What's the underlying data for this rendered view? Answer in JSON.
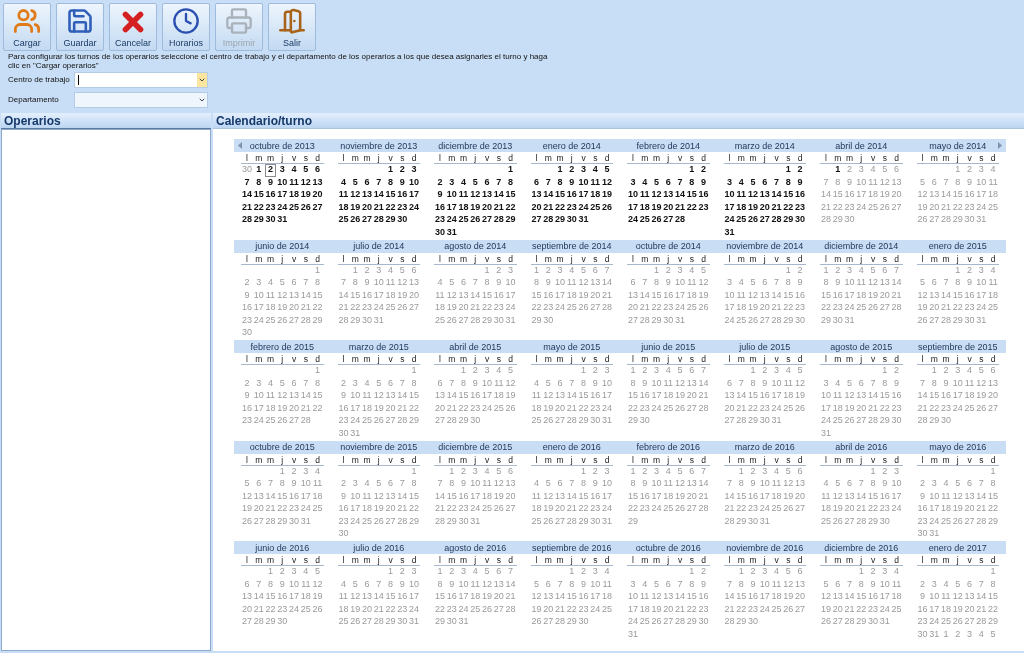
{
  "toolbar": [
    {
      "label": "Cargar",
      "kind": "users",
      "disabled": false
    },
    {
      "label": "Guardar",
      "kind": "save",
      "disabled": false
    },
    {
      "label": "Cancelar",
      "kind": "cancel",
      "disabled": false
    },
    {
      "label": "Horarios",
      "kind": "clock",
      "disabled": false
    },
    {
      "label": "Imprimir",
      "kind": "print",
      "disabled": true
    },
    {
      "label": "Salir",
      "kind": "exit",
      "disabled": false
    }
  ],
  "instructions": "Para configurar los turnos de los operarios seleccione el centro de trabajo y el departamento de los operarios a los que desea asignarles el turno y haga clic en \"Cargar operarios\"",
  "fields": [
    {
      "label": "Centro de trabajo",
      "focused": true
    },
    {
      "label": "Departamento",
      "focused": false
    }
  ],
  "operators_panel": {
    "title": "Operarios"
  },
  "calendar": {
    "title": "Calendario/turno",
    "months": [
      {
        "title": "octubre de 2013",
        "active": true,
        "today_is_second_day": true,
        "weekdays": [
          "l",
          "m",
          "m",
          "j",
          "v",
          "s",
          "d"
        ],
        "prev_days": [
          "30"
        ],
        "weeks": [
          [
            "1",
            "2",
            "3",
            "4",
            "5",
            "6"
          ],
          [
            "7",
            "8",
            "9",
            "10",
            "11",
            "12",
            "13"
          ],
          [
            "14",
            "15",
            "16",
            "17",
            "18",
            "19",
            "20"
          ],
          [
            "21",
            "22",
            "23",
            "24",
            "25",
            "26",
            "27"
          ],
          [
            "28",
            "29",
            "30",
            "31"
          ]
        ]
      },
      {
        "title": "noviembre de 2013",
        "active": true,
        "weekdays": [
          "l",
          "m",
          "m",
          "j",
          "v",
          "s",
          "d"
        ],
        "weeks": [
          [
            "1",
            "2",
            "3"
          ],
          [
            "4",
            "5",
            "6",
            "7",
            "8",
            "9",
            "10"
          ],
          [
            "11",
            "12",
            "13",
            "14",
            "15",
            "16",
            "17"
          ],
          [
            "18",
            "19",
            "20",
            "21",
            "22",
            "23",
            "24"
          ],
          [
            "25",
            "26",
            "27",
            "28",
            "29",
            "30"
          ]
        ]
      },
      {
        "title": "diciembre de 2013",
        "active": true,
        "weekdays": [
          "l",
          "m",
          "m",
          "j",
          "v",
          "s",
          "d"
        ],
        "weeks": [
          [
            "1"
          ],
          [
            "2",
            "3",
            "4",
            "5",
            "6",
            "7",
            "8"
          ],
          [
            "9",
            "10",
            "11",
            "12",
            "13",
            "14",
            "15"
          ],
          [
            "16",
            "17",
            "18",
            "19",
            "20",
            "21",
            "22"
          ],
          [
            "23",
            "24",
            "25",
            "26",
            "27",
            "28",
            "29"
          ],
          [
            "30",
            "31"
          ]
        ]
      },
      {
        "title": "enero de 2014",
        "active": true,
        "weekdays": [
          "l",
          "m",
          "m",
          "j",
          "v",
          "s",
          "d"
        ],
        "weeks": [
          [
            "1",
            "2",
            "3",
            "4",
            "5"
          ],
          [
            "6",
            "7",
            "8",
            "9",
            "10",
            "11",
            "12"
          ],
          [
            "13",
            "14",
            "15",
            "16",
            "17",
            "18",
            "19"
          ],
          [
            "20",
            "21",
            "22",
            "23",
            "24",
            "25",
            "26"
          ],
          [
            "27",
            "28",
            "29",
            "30",
            "31"
          ]
        ]
      },
      {
        "title": "febrero de 2014",
        "active": true,
        "weekdays": [
          "l",
          "m",
          "m",
          "j",
          "v",
          "s",
          "d"
        ],
        "weeks": [
          [
            "1",
            "2"
          ],
          [
            "3",
            "4",
            "5",
            "6",
            "7",
            "8",
            "9"
          ],
          [
            "10",
            "11",
            "12",
            "13",
            "14",
            "15",
            "16"
          ],
          [
            "17",
            "18",
            "19",
            "20",
            "21",
            "22",
            "23"
          ],
          [
            "24",
            "25",
            "26",
            "27",
            "28"
          ]
        ]
      },
      {
        "title": "marzo de 2014",
        "active": true,
        "weekdays": [
          "l",
          "m",
          "m",
          "j",
          "v",
          "s",
          "d"
        ],
        "weeks": [
          [
            "1",
            "2"
          ],
          [
            "3",
            "4",
            "5",
            "6",
            "7",
            "8",
            "9"
          ],
          [
            "10",
            "11",
            "12",
            "13",
            "14",
            "15",
            "16"
          ],
          [
            "17",
            "18",
            "19",
            "20",
            "21",
            "22",
            "23"
          ],
          [
            "24",
            "25",
            "26",
            "27",
            "28",
            "29",
            "30"
          ],
          [
            "31"
          ]
        ]
      },
      {
        "title": "abril de 2014",
        "active": false,
        "weekdays": [
          "l",
          "m",
          "m",
          "j",
          "v",
          "s",
          "d"
        ],
        "active_lead_days": [
          "1"
        ],
        "weeks": [
          [
            "2",
            "3",
            "4",
            "5",
            "6"
          ],
          [
            "7",
            "8",
            "9",
            "10",
            "11",
            "12",
            "13"
          ],
          [
            "14",
            "15",
            "16",
            "17",
            "18",
            "19",
            "20"
          ],
          [
            "21",
            "22",
            "23",
            "24",
            "25",
            "26",
            "27"
          ],
          [
            "28",
            "29",
            "30"
          ]
        ]
      },
      {
        "title": "mayo de 2014",
        "active": false,
        "weekdays": [
          "l",
          "m",
          "m",
          "j",
          "v",
          "s",
          "d"
        ],
        "weeks": [
          [
            "1",
            "2",
            "3",
            "4"
          ],
          [
            "5",
            "6",
            "7",
            "8",
            "9",
            "10",
            "11"
          ],
          [
            "12",
            "13",
            "14",
            "15",
            "16",
            "17",
            "18"
          ],
          [
            "19",
            "20",
            "21",
            "22",
            "23",
            "24",
            "25"
          ],
          [
            "26",
            "27",
            "28",
            "29",
            "30",
            "31"
          ]
        ]
      },
      {
        "title": "junio de 2014",
        "active": false,
        "weekdays": [
          "l",
          "m",
          "m",
          "j",
          "v",
          "s",
          "d"
        ],
        "weeks": [
          [
            "1"
          ],
          [
            "2",
            "3",
            "4",
            "5",
            "6",
            "7",
            "8"
          ],
          [
            "9",
            "10",
            "11",
            "12",
            "13",
            "14",
            "15"
          ],
          [
            "16",
            "17",
            "18",
            "19",
            "20",
            "21",
            "22"
          ],
          [
            "23",
            "24",
            "25",
            "26",
            "27",
            "28",
            "29"
          ],
          [
            "30"
          ]
        ]
      },
      {
        "title": "julio de 2014",
        "active": false,
        "weekdays": [
          "l",
          "m",
          "m",
          "j",
          "v",
          "s",
          "d"
        ],
        "weeks": [
          [
            "1",
            "2",
            "3",
            "4",
            "5",
            "6"
          ],
          [
            "7",
            "8",
            "9",
            "10",
            "11",
            "12",
            "13"
          ],
          [
            "14",
            "15",
            "16",
            "17",
            "18",
            "19",
            "20"
          ],
          [
            "21",
            "22",
            "23",
            "24",
            "25",
            "26",
            "27"
          ],
          [
            "28",
            "29",
            "30",
            "31"
          ]
        ]
      },
      {
        "title": "agosto de 2014",
        "active": false,
        "weekdays": [
          "l",
          "m",
          "m",
          "j",
          "v",
          "s",
          "d"
        ],
        "weeks": [
          [
            "1",
            "2",
            "3"
          ],
          [
            "4",
            "5",
            "6",
            "7",
            "8",
            "9",
            "10"
          ],
          [
            "11",
            "12",
            "13",
            "14",
            "15",
            "16",
            "17"
          ],
          [
            "18",
            "19",
            "20",
            "21",
            "22",
            "23",
            "24"
          ],
          [
            "25",
            "26",
            "27",
            "28",
            "29",
            "30",
            "31"
          ]
        ]
      },
      {
        "title": "septiembre de 2014",
        "active": false,
        "weekdays": [
          "l",
          "m",
          "m",
          "j",
          "v",
          "s",
          "d"
        ],
        "weeks": [
          [
            "1",
            "2",
            "3",
            "4",
            "5",
            "6",
            "7"
          ],
          [
            "8",
            "9",
            "10",
            "11",
            "12",
            "13",
            "14"
          ],
          [
            "15",
            "16",
            "17",
            "18",
            "19",
            "20",
            "21"
          ],
          [
            "22",
            "23",
            "24",
            "25",
            "26",
            "27",
            "28"
          ],
          [
            "29",
            "30"
          ]
        ]
      },
      {
        "title": "octubre de 2014",
        "active": false,
        "weekdays": [
          "l",
          "m",
          "m",
          "j",
          "v",
          "s",
          "d"
        ],
        "weeks": [
          [
            "1",
            "2",
            "3",
            "4",
            "5"
          ],
          [
            "6",
            "7",
            "8",
            "9",
            "10",
            "11",
            "12"
          ],
          [
            "13",
            "14",
            "15",
            "16",
            "17",
            "18",
            "19"
          ],
          [
            "20",
            "21",
            "22",
            "23",
            "24",
            "25",
            "26"
          ],
          [
            "27",
            "28",
            "29",
            "30",
            "31"
          ]
        ]
      },
      {
        "title": "noviembre de 2014",
        "active": false,
        "weekdays": [
          "l",
          "m",
          "m",
          "j",
          "v",
          "s",
          "d"
        ],
        "weeks": [
          [
            "1",
            "2"
          ],
          [
            "3",
            "4",
            "5",
            "6",
            "7",
            "8",
            "9"
          ],
          [
            "10",
            "11",
            "12",
            "13",
            "14",
            "15",
            "16"
          ],
          [
            "17",
            "18",
            "19",
            "20",
            "21",
            "22",
            "23"
          ],
          [
            "24",
            "25",
            "26",
            "27",
            "28",
            "29",
            "30"
          ]
        ]
      },
      {
        "title": "diciembre de 2014",
        "active": false,
        "weekdays": [
          "l",
          "m",
          "m",
          "j",
          "v",
          "s",
          "d"
        ],
        "weeks": [
          [
            "1",
            "2",
            "3",
            "4",
            "5",
            "6",
            "7"
          ],
          [
            "8",
            "9",
            "10",
            "11",
            "12",
            "13",
            "14"
          ],
          [
            "15",
            "16",
            "17",
            "18",
            "19",
            "20",
            "21"
          ],
          [
            "22",
            "23",
            "24",
            "25",
            "26",
            "27",
            "28"
          ],
          [
            "29",
            "30",
            "31"
          ]
        ]
      },
      {
        "title": "enero de 2015",
        "active": false,
        "weekdays": [
          "l",
          "m",
          "m",
          "j",
          "v",
          "s",
          "d"
        ],
        "weeks": [
          [
            "1",
            "2",
            "3",
            "4"
          ],
          [
            "5",
            "6",
            "7",
            "8",
            "9",
            "10",
            "11"
          ],
          [
            "12",
            "13",
            "14",
            "15",
            "16",
            "17",
            "18"
          ],
          [
            "19",
            "20",
            "21",
            "22",
            "23",
            "24",
            "25"
          ],
          [
            "26",
            "27",
            "28",
            "29",
            "30",
            "31"
          ]
        ]
      },
      {
        "title": "febrero de 2015",
        "active": false,
        "weekdays": [
          "l",
          "m",
          "m",
          "j",
          "v",
          "s",
          "d"
        ],
        "weeks": [
          [
            "1"
          ],
          [
            "2",
            "3",
            "4",
            "5",
            "6",
            "7",
            "8"
          ],
          [
            "9",
            "10",
            "11",
            "12",
            "13",
            "14",
            "15"
          ],
          [
            "16",
            "17",
            "18",
            "19",
            "20",
            "21",
            "22"
          ],
          [
            "23",
            "24",
            "25",
            "26",
            "27",
            "28"
          ]
        ]
      },
      {
        "title": "marzo de 2015",
        "active": false,
        "weekdays": [
          "l",
          "m",
          "m",
          "j",
          "v",
          "s",
          "d"
        ],
        "weeks": [
          [
            "1"
          ],
          [
            "2",
            "3",
            "4",
            "5",
            "6",
            "7",
            "8"
          ],
          [
            "9",
            "10",
            "11",
            "12",
            "13",
            "14",
            "15"
          ],
          [
            "16",
            "17",
            "18",
            "19",
            "20",
            "21",
            "22"
          ],
          [
            "23",
            "24",
            "25",
            "26",
            "27",
            "28",
            "29"
          ],
          [
            "30",
            "31"
          ]
        ]
      },
      {
        "title": "abril de 2015",
        "active": false,
        "weekdays": [
          "l",
          "m",
          "m",
          "j",
          "v",
          "s",
          "d"
        ],
        "weeks": [
          [
            "1",
            "2",
            "3",
            "4",
            "5"
          ],
          [
            "6",
            "7",
            "8",
            "9",
            "10",
            "11",
            "12"
          ],
          [
            "13",
            "14",
            "15",
            "16",
            "17",
            "18",
            "19"
          ],
          [
            "20",
            "21",
            "22",
            "23",
            "24",
            "25",
            "26"
          ],
          [
            "27",
            "28",
            "29",
            "30"
          ]
        ]
      },
      {
        "title": "mayo de 2015",
        "active": false,
        "weekdays": [
          "l",
          "m",
          "m",
          "j",
          "v",
          "s",
          "d"
        ],
        "weeks": [
          [
            "1",
            "2",
            "3"
          ],
          [
            "4",
            "5",
            "6",
            "7",
            "8",
            "9",
            "10"
          ],
          [
            "11",
            "12",
            "13",
            "14",
            "15",
            "16",
            "17"
          ],
          [
            "18",
            "19",
            "20",
            "21",
            "22",
            "23",
            "24"
          ],
          [
            "25",
            "26",
            "27",
            "28",
            "29",
            "30",
            "31"
          ]
        ]
      },
      {
        "title": "junio de 2015",
        "active": false,
        "weekdays": [
          "l",
          "m",
          "m",
          "j",
          "v",
          "s",
          "d"
        ],
        "weeks": [
          [
            "1",
            "2",
            "3",
            "4",
            "5",
            "6",
            "7"
          ],
          [
            "8",
            "9",
            "10",
            "11",
            "12",
            "13",
            "14"
          ],
          [
            "15",
            "16",
            "17",
            "18",
            "19",
            "20",
            "21"
          ],
          [
            "22",
            "23",
            "24",
            "25",
            "26",
            "27",
            "28"
          ],
          [
            "29",
            "30"
          ]
        ]
      },
      {
        "title": "julio de 2015",
        "active": false,
        "weekdays": [
          "l",
          "m",
          "m",
          "j",
          "v",
          "s",
          "d"
        ],
        "weeks": [
          [
            "1",
            "2",
            "3",
            "4",
            "5"
          ],
          [
            "6",
            "7",
            "8",
            "9",
            "10",
            "11",
            "12"
          ],
          [
            "13",
            "14",
            "15",
            "16",
            "17",
            "18",
            "19"
          ],
          [
            "20",
            "21",
            "22",
            "23",
            "24",
            "25",
            "26"
          ],
          [
            "27",
            "28",
            "29",
            "30",
            "31"
          ]
        ]
      },
      {
        "title": "agosto de 2015",
        "active": false,
        "weekdays": [
          "l",
          "m",
          "m",
          "j",
          "v",
          "s",
          "d"
        ],
        "weeks": [
          [
            "1",
            "2"
          ],
          [
            "3",
            "4",
            "5",
            "6",
            "7",
            "8",
            "9"
          ],
          [
            "10",
            "11",
            "12",
            "13",
            "14",
            "15",
            "16"
          ],
          [
            "17",
            "18",
            "19",
            "20",
            "21",
            "22",
            "23"
          ],
          [
            "24",
            "25",
            "26",
            "27",
            "28",
            "29",
            "30"
          ],
          [
            "31"
          ]
        ]
      },
      {
        "title": "septiembre de 2015",
        "active": false,
        "weekdays": [
          "l",
          "m",
          "m",
          "j",
          "v",
          "s",
          "d"
        ],
        "weeks": [
          [
            "1",
            "2",
            "3",
            "4",
            "5",
            "6"
          ],
          [
            "7",
            "8",
            "9",
            "10",
            "11",
            "12",
            "13"
          ],
          [
            "14",
            "15",
            "16",
            "17",
            "18",
            "19",
            "20"
          ],
          [
            "21",
            "22",
            "23",
            "24",
            "25",
            "26",
            "27"
          ],
          [
            "28",
            "29",
            "30"
          ]
        ]
      },
      {
        "title": "octubre de 2015",
        "active": false,
        "weekdays": [
          "l",
          "m",
          "m",
          "j",
          "v",
          "s",
          "d"
        ],
        "weeks": [
          [
            "1",
            "2",
            "3",
            "4"
          ],
          [
            "5",
            "6",
            "7",
            "8",
            "9",
            "10",
            "11"
          ],
          [
            "12",
            "13",
            "14",
            "15",
            "16",
            "17",
            "18"
          ],
          [
            "19",
            "20",
            "21",
            "22",
            "23",
            "24",
            "25"
          ],
          [
            "26",
            "27",
            "28",
            "29",
            "30",
            "31"
          ]
        ]
      },
      {
        "title": "noviembre de 2015",
        "active": false,
        "weekdays": [
          "l",
          "m",
          "m",
          "j",
          "v",
          "s",
          "d"
        ],
        "weeks": [
          [
            "1"
          ],
          [
            "2",
            "3",
            "4",
            "5",
            "6",
            "7",
            "8"
          ],
          [
            "9",
            "10",
            "11",
            "12",
            "13",
            "14",
            "15"
          ],
          [
            "16",
            "17",
            "18",
            "19",
            "20",
            "21",
            "22"
          ],
          [
            "23",
            "24",
            "25",
            "26",
            "27",
            "28",
            "29"
          ],
          [
            "30"
          ]
        ]
      },
      {
        "title": "diciembre de 2015",
        "active": false,
        "weekdays": [
          "l",
          "m",
          "m",
          "j",
          "v",
          "s",
          "d"
        ],
        "weeks": [
          [
            "1",
            "2",
            "3",
            "4",
            "5",
            "6"
          ],
          [
            "7",
            "8",
            "9",
            "10",
            "11",
            "12",
            "13"
          ],
          [
            "14",
            "15",
            "16",
            "17",
            "18",
            "19",
            "20"
          ],
          [
            "21",
            "22",
            "23",
            "24",
            "25",
            "26",
            "27"
          ],
          [
            "28",
            "29",
            "30",
            "31"
          ]
        ]
      },
      {
        "title": "enero de 2016",
        "active": false,
        "weekdays": [
          "l",
          "m",
          "m",
          "j",
          "v",
          "s",
          "d"
        ],
        "weeks": [
          [
            "1",
            "2",
            "3"
          ],
          [
            "4",
            "5",
            "6",
            "7",
            "8",
            "9",
            "10"
          ],
          [
            "11",
            "12",
            "13",
            "14",
            "15",
            "16",
            "17"
          ],
          [
            "18",
            "19",
            "20",
            "21",
            "22",
            "23",
            "24"
          ],
          [
            "25",
            "26",
            "27",
            "28",
            "29",
            "30",
            "31"
          ]
        ]
      },
      {
        "title": "febrero de 2016",
        "active": false,
        "weekdays": [
          "l",
          "m",
          "m",
          "j",
          "v",
          "s",
          "d"
        ],
        "weeks": [
          [
            "1",
            "2",
            "3",
            "4",
            "5",
            "6",
            "7"
          ],
          [
            "8",
            "9",
            "10",
            "11",
            "12",
            "13",
            "14"
          ],
          [
            "15",
            "16",
            "17",
            "18",
            "19",
            "20",
            "21"
          ],
          [
            "22",
            "23",
            "24",
            "25",
            "26",
            "27",
            "28"
          ],
          [
            "29"
          ]
        ]
      },
      {
        "title": "marzo de 2016",
        "active": false,
        "weekdays": [
          "l",
          "m",
          "m",
          "j",
          "v",
          "s",
          "d"
        ],
        "weeks": [
          [
            "1",
            "2",
            "3",
            "4",
            "5",
            "6"
          ],
          [
            "7",
            "8",
            "9",
            "10",
            "11",
            "12",
            "13"
          ],
          [
            "14",
            "15",
            "16",
            "17",
            "18",
            "19",
            "20"
          ],
          [
            "21",
            "22",
            "23",
            "24",
            "25",
            "26",
            "27"
          ],
          [
            "28",
            "29",
            "30",
            "31"
          ]
        ]
      },
      {
        "title": "abril de 2016",
        "active": false,
        "weekdays": [
          "l",
          "m",
          "m",
          "j",
          "v",
          "s",
          "d"
        ],
        "weeks": [
          [
            "1",
            "2",
            "3"
          ],
          [
            "4",
            "5",
            "6",
            "7",
            "8",
            "9",
            "10"
          ],
          [
            "11",
            "12",
            "13",
            "14",
            "15",
            "16",
            "17"
          ],
          [
            "18",
            "19",
            "20",
            "21",
            "22",
            "23",
            "24"
          ],
          [
            "25",
            "26",
            "27",
            "28",
            "29",
            "30"
          ]
        ]
      },
      {
        "title": "mayo de 2016",
        "active": false,
        "weekdays": [
          "l",
          "m",
          "m",
          "j",
          "v",
          "s",
          "d"
        ],
        "weeks": [
          [
            "1"
          ],
          [
            "2",
            "3",
            "4",
            "5",
            "6",
            "7",
            "8"
          ],
          [
            "9",
            "10",
            "11",
            "12",
            "13",
            "14",
            "15"
          ],
          [
            "16",
            "17",
            "18",
            "19",
            "20",
            "21",
            "22"
          ],
          [
            "23",
            "24",
            "25",
            "26",
            "27",
            "28",
            "29"
          ],
          [
            "30",
            "31"
          ]
        ]
      },
      {
        "title": "junio de 2016",
        "active": false,
        "weekdays": [
          "l",
          "m",
          "m",
          "j",
          "v",
          "s",
          "d"
        ],
        "weeks": [
          [
            "1",
            "2",
            "3",
            "4",
            "5"
          ],
          [
            "6",
            "7",
            "8",
            "9",
            "10",
            "11",
            "12"
          ],
          [
            "13",
            "14",
            "15",
            "16",
            "17",
            "18",
            "19"
          ],
          [
            "20",
            "21",
            "22",
            "23",
            "24",
            "25",
            "26"
          ],
          [
            "27",
            "28",
            "29",
            "30"
          ]
        ]
      },
      {
        "title": "julio de 2016",
        "active": false,
        "weekdays": [
          "l",
          "m",
          "m",
          "j",
          "v",
          "s",
          "d"
        ],
        "weeks": [
          [
            "1",
            "2",
            "3"
          ],
          [
            "4",
            "5",
            "6",
            "7",
            "8",
            "9",
            "10"
          ],
          [
            "11",
            "12",
            "13",
            "14",
            "15",
            "16",
            "17"
          ],
          [
            "18",
            "19",
            "20",
            "21",
            "22",
            "23",
            "24"
          ],
          [
            "25",
            "26",
            "27",
            "28",
            "29",
            "30",
            "31"
          ]
        ]
      },
      {
        "title": "agosto de 2016",
        "active": false,
        "weekdays": [
          "l",
          "m",
          "m",
          "j",
          "v",
          "s",
          "d"
        ],
        "weeks": [
          [
            "1",
            "2",
            "3",
            "4",
            "5",
            "6",
            "7"
          ],
          [
            "8",
            "9",
            "10",
            "11",
            "12",
            "13",
            "14"
          ],
          [
            "15",
            "16",
            "17",
            "18",
            "19",
            "20",
            "21"
          ],
          [
            "22",
            "23",
            "24",
            "25",
            "26",
            "27",
            "28"
          ],
          [
            "29",
            "30",
            "31"
          ]
        ]
      },
      {
        "title": "septiembre de 2016",
        "active": false,
        "weekdays": [
          "l",
          "m",
          "m",
          "j",
          "v",
          "s",
          "d"
        ],
        "weeks": [
          [
            "1",
            "2",
            "3",
            "4"
          ],
          [
            "5",
            "6",
            "7",
            "8",
            "9",
            "10",
            "11"
          ],
          [
            "12",
            "13",
            "14",
            "15",
            "16",
            "17",
            "18"
          ],
          [
            "19",
            "20",
            "21",
            "22",
            "23",
            "24",
            "25"
          ],
          [
            "26",
            "27",
            "28",
            "29",
            "30"
          ]
        ]
      },
      {
        "title": "octubre de 2016",
        "active": false,
        "weekdays": [
          "l",
          "m",
          "m",
          "j",
          "v",
          "s",
          "d"
        ],
        "weeks": [
          [
            "1",
            "2"
          ],
          [
            "3",
            "4",
            "5",
            "6",
            "7",
            "8",
            "9"
          ],
          [
            "10",
            "11",
            "12",
            "13",
            "14",
            "15",
            "16"
          ],
          [
            "17",
            "18",
            "19",
            "20",
            "21",
            "22",
            "23"
          ],
          [
            "24",
            "25",
            "26",
            "27",
            "28",
            "29",
            "30"
          ],
          [
            "31"
          ]
        ]
      },
      {
        "title": "noviembre de 2016",
        "active": false,
        "weekdays": [
          "l",
          "m",
          "m",
          "j",
          "v",
          "s",
          "d"
        ],
        "weeks": [
          [
            "1",
            "2",
            "3",
            "4",
            "5",
            "6"
          ],
          [
            "7",
            "8",
            "9",
            "10",
            "11",
            "12",
            "13"
          ],
          [
            "14",
            "15",
            "16",
            "17",
            "18",
            "19",
            "20"
          ],
          [
            "21",
            "22",
            "23",
            "24",
            "25",
            "26",
            "27"
          ],
          [
            "28",
            "29",
            "30"
          ]
        ]
      },
      {
        "title": "diciembre de 2016",
        "active": false,
        "weekdays": [
          "l",
          "m",
          "m",
          "j",
          "v",
          "s",
          "d"
        ],
        "weeks": [
          [
            "1",
            "2",
            "3",
            "4"
          ],
          [
            "5",
            "6",
            "7",
            "8",
            "9",
            "10",
            "11"
          ],
          [
            "12",
            "13",
            "14",
            "15",
            "16",
            "17",
            "18"
          ],
          [
            "19",
            "20",
            "21",
            "22",
            "23",
            "24",
            "25"
          ],
          [
            "26",
            "27",
            "28",
            "29",
            "30",
            "31"
          ]
        ]
      },
      {
        "title": "enero de 2017",
        "active": false,
        "weekdays": [
          "l",
          "m",
          "m",
          "j",
          "v",
          "s",
          "d"
        ],
        "next_days": [
          "1",
          "2",
          "3",
          "4",
          "5"
        ],
        "weeks": [
          [
            "1"
          ],
          [
            "2",
            "3",
            "4",
            "5",
            "6",
            "7",
            "8"
          ],
          [
            "9",
            "10",
            "11",
            "12",
            "13",
            "14",
            "15"
          ],
          [
            "16",
            "17",
            "18",
            "19",
            "20",
            "21",
            "22"
          ],
          [
            "23",
            "24",
            "25",
            "26",
            "27",
            "28",
            "29"
          ],
          [
            "30",
            "31"
          ]
        ]
      }
    ]
  }
}
